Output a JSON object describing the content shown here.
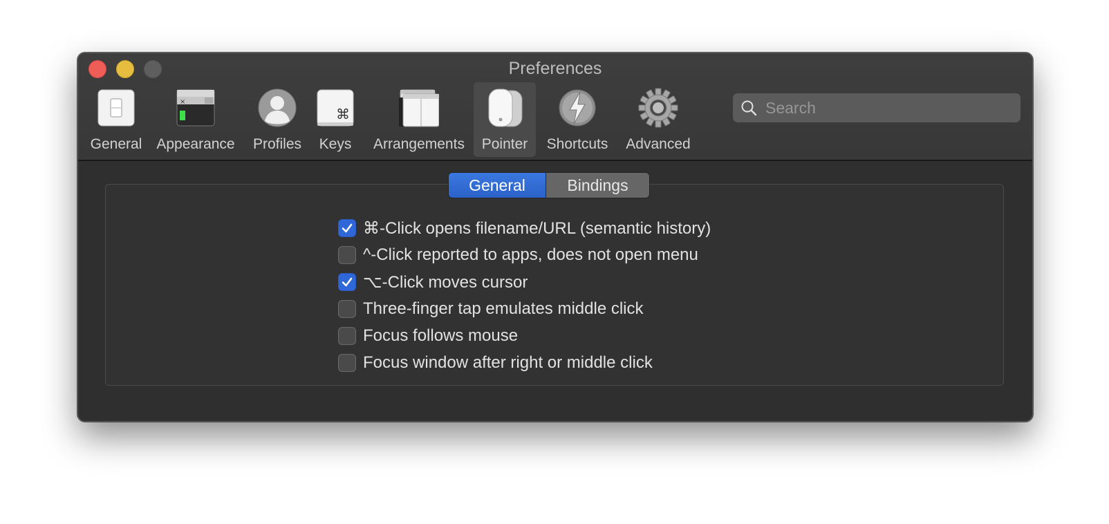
{
  "window": {
    "title": "Preferences"
  },
  "toolbar": {
    "items": [
      {
        "label": "General",
        "icon": "general-switch-icon",
        "selected": false
      },
      {
        "label": "Appearance",
        "icon": "appearance-window-icon",
        "selected": false
      },
      {
        "label": "Profiles",
        "icon": "profiles-user-icon",
        "selected": false
      },
      {
        "label": "Keys",
        "icon": "keys-command-icon",
        "selected": false
      },
      {
        "label": "Arrangements",
        "icon": "arrangements-windows-icon",
        "selected": false
      },
      {
        "label": "Pointer",
        "icon": "pointer-mouse-icon",
        "selected": true
      },
      {
        "label": "Shortcuts",
        "icon": "shortcuts-lightning-icon",
        "selected": false
      },
      {
        "label": "Advanced",
        "icon": "advanced-gear-icon",
        "selected": false
      }
    ],
    "search_placeholder": "Search",
    "keys_glyph": "⌘"
  },
  "segmented": {
    "general": "General",
    "bindings": "Bindings",
    "selected": "General"
  },
  "options": [
    {
      "label": "⌘-Click opens filename/URL (semantic history)",
      "checked": true
    },
    {
      "label": "^-Click reported to apps, does not open menu",
      "checked": false
    },
    {
      "label": "⌥-Click moves cursor",
      "checked": true
    },
    {
      "label": "Three-finger tap emulates middle click",
      "checked": false
    },
    {
      "label": "Focus follows mouse",
      "checked": false
    },
    {
      "label": "Focus window after right or middle click",
      "checked": false
    }
  ],
  "colors": {
    "accent": "#2f67d8",
    "close": "#ee5e57",
    "minimize": "#e6bd3f",
    "zoom": "#5e5e5e"
  }
}
